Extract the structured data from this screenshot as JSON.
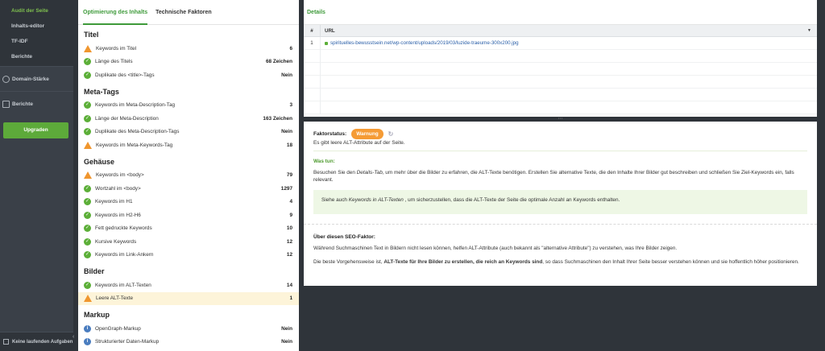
{
  "sidebar": {
    "sub_items": [
      "Audit der Seite",
      "Inhalts-editor",
      "TF-IDF",
      "Berichte"
    ],
    "main_items": [
      {
        "label": "Domain-Stärke",
        "icon": "gauge-icon"
      },
      {
        "label": "Berichte",
        "icon": "report-icon"
      }
    ],
    "upgrade_label": "Upgraden",
    "bottom_label": "Keine laufenden Aufgaben",
    "collapse_icon": "‹"
  },
  "left_panel": {
    "tabs": [
      "Optimierung des Inhalts",
      "Technische Faktoren"
    ],
    "sections": [
      {
        "title": "Titel",
        "rows": [
          {
            "status": "warn",
            "label": "Keywords im Titel",
            "value": "6"
          },
          {
            "status": "ok",
            "label": "Länge des Titels",
            "value": "68 Zeichen"
          },
          {
            "status": "ok",
            "label": "Duplikate des <title>-Tags",
            "value": "Nein"
          }
        ]
      },
      {
        "title": "Meta-Tags",
        "rows": [
          {
            "status": "ok",
            "label": "Keywords im Meta-Description-Tag",
            "value": "3"
          },
          {
            "status": "ok",
            "label": "Länge der Meta-Description",
            "value": "163 Zeichen"
          },
          {
            "status": "ok",
            "label": "Duplikate des Meta-Description-Tags",
            "value": "Nein"
          },
          {
            "status": "warn",
            "label": "Keywords im Meta-Keywords-Tag",
            "value": "18"
          }
        ]
      },
      {
        "title": "Gehäuse",
        "rows": [
          {
            "status": "warn",
            "label": "Keywords im <body>",
            "value": "79"
          },
          {
            "status": "ok",
            "label": "Wortzahl im <body>",
            "value": "1297"
          },
          {
            "status": "ok",
            "label": "Keywords im H1",
            "value": "4"
          },
          {
            "status": "ok",
            "label": "Keywords im H2-H6",
            "value": "9"
          },
          {
            "status": "ok",
            "label": "Fett gedruckte Keywords",
            "value": "10"
          },
          {
            "status": "ok",
            "label": "Kursive Keywords",
            "value": "12"
          },
          {
            "status": "ok",
            "label": "Keywords im Link-Ankern",
            "value": "12"
          }
        ]
      },
      {
        "title": "Bilder",
        "rows": [
          {
            "status": "ok",
            "label": "Keywords im ALT-Texten",
            "value": "14"
          },
          {
            "status": "warn",
            "label": "Leere ALT-Texte",
            "value": "1",
            "highlight": true
          }
        ]
      },
      {
        "title": "Markup",
        "rows": [
          {
            "status": "info",
            "label": "OpenGraph-Markup",
            "value": "Nein"
          },
          {
            "status": "info",
            "label": "Strukturierter Daten-Markup",
            "value": "Nein"
          }
        ]
      }
    ]
  },
  "details": {
    "tab": "Details",
    "col_num": "#",
    "col_url": "URL",
    "rows": [
      {
        "num": "1",
        "url": "spirituelles-bewusstsein.net/wp-content/uploads/2019/03/luzide-traeume-300x200.jpg"
      }
    ]
  },
  "factor": {
    "status_label": "Faktorstatus:",
    "badge": "Warnung",
    "summary": "Es gibt leere ALT-Attribute auf der Seite.",
    "todo_title": "Was tun:",
    "todo_pre": "Besuchen Sie den ",
    "todo_italic": "Details-Tab",
    "todo_post": ", um mehr über die Bilder zu erfahren, die ALT-Texte benötigen. Erstellen Sie alternative Texte, die den Inhalte Ihrer Bilder gut beschreiben und schließen Sie Ziel-Keywords ein, falls relevant.",
    "note_pre": "Siehe auch ",
    "note_italic": "Keywords in ALT-Texten",
    "note_post": " , um sicherzustellen, dass die ALT-Texte der Seite die optimale Anzahl an Keywords enthalten.",
    "about_title": "Über diesen SEO-Faktor:",
    "about_p1": "Während Suchmaschinen Text in Bildern nicht lesen können, helfen ALT-Attribute (auch bekannt als \"alternative Attribute\") zu verstehen, was Ihre Bilder zeigen.",
    "about_p2_pre": "Die beste Vorgehensweise ist, ",
    "about_p2_bold": "ALT-Texte für Ihre Bilder zu erstellen, die reich an Keywords sind",
    "about_p2_post": ", so dass Suchmaschinen den Inhalt Ihrer Seite besser verstehen können und sie hoffentlich höher positionieren."
  },
  "colors": {
    "accent": "#3e9a3a",
    "warning": "#f0962e",
    "ok": "#5caf38",
    "info": "#4a7dbf"
  }
}
